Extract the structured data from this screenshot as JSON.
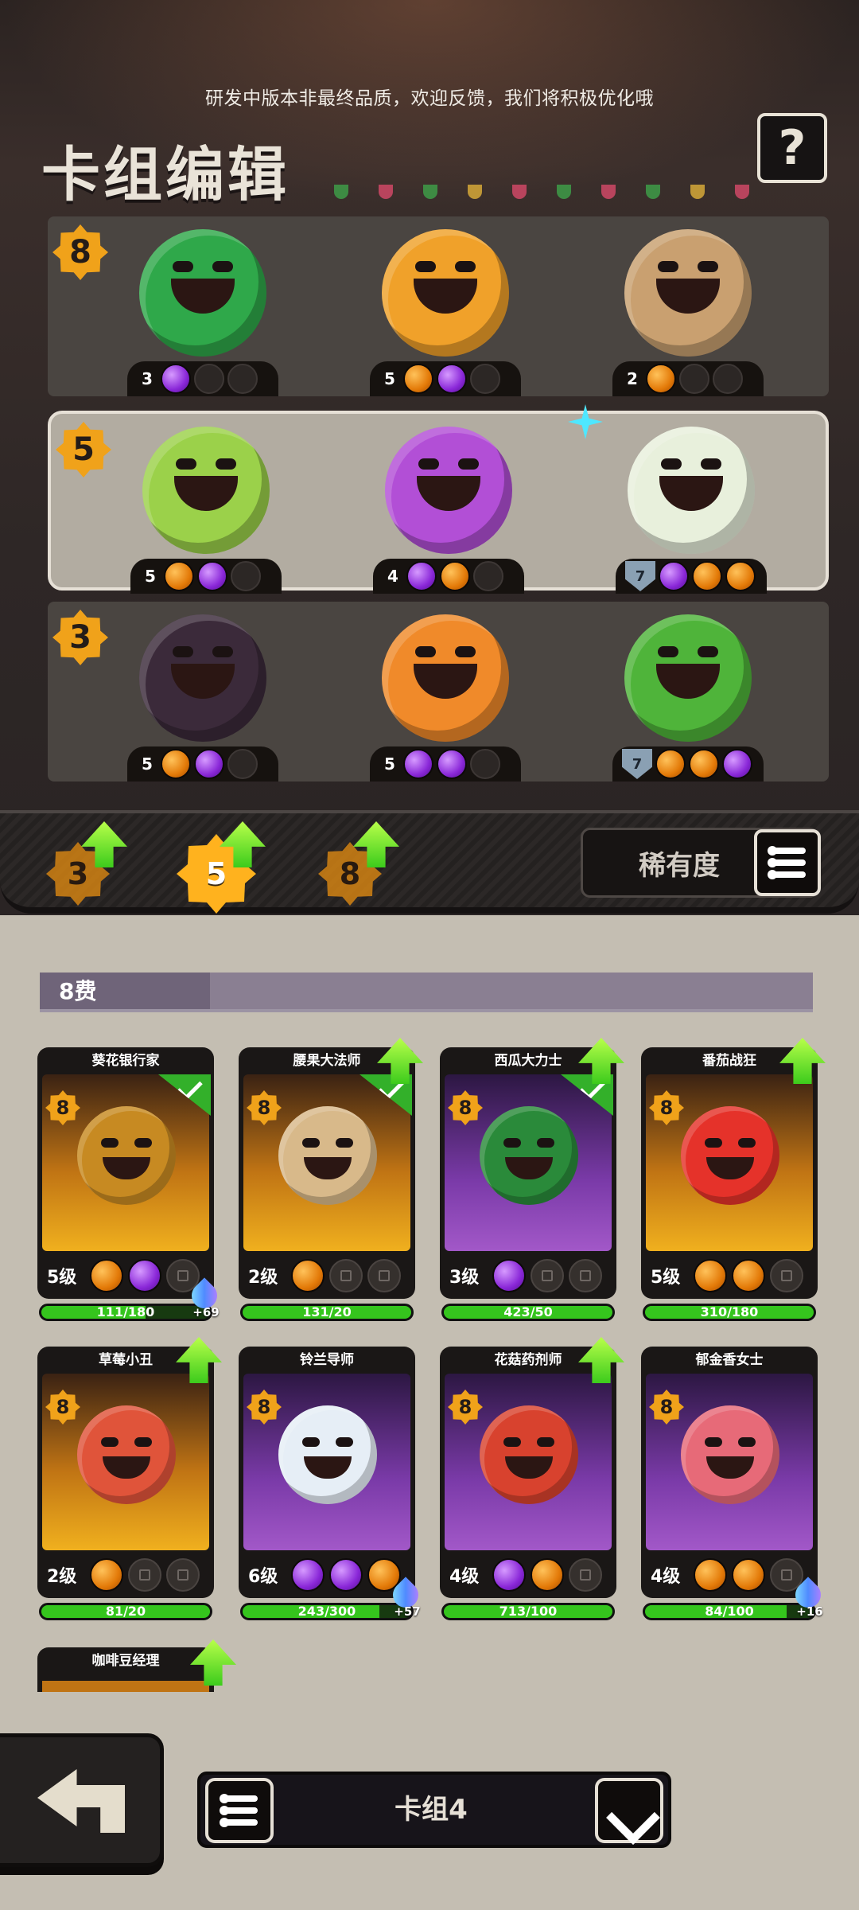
{
  "notice": "研发中版本非最终品质，欢迎反馈，我们将积极优化哦",
  "title": "卡组编辑",
  "help_label": "?",
  "deck_rows": [
    {
      "cost": "8",
      "slots": [
        {
          "level": "3",
          "gems": [
            "purple",
            "empty",
            "empty"
          ],
          "color": "#2fa84a"
        },
        {
          "level": "5",
          "gems": [
            "orange",
            "purple",
            "empty"
          ],
          "color": "#f0a12a"
        },
        {
          "level": "2",
          "gems": [
            "orange",
            "empty",
            "empty"
          ],
          "color": "#c9a070"
        }
      ]
    },
    {
      "cost": "5",
      "slots": [
        {
          "level": "5",
          "gems": [
            "orange",
            "purple",
            "empty"
          ],
          "color": "#9bd14a"
        },
        {
          "level": "4",
          "gems": [
            "purple",
            "orange",
            "empty"
          ],
          "color": "#b24fd6"
        },
        {
          "level": "7",
          "gems": [
            "purple",
            "orange",
            "orange"
          ],
          "color": "#e8f0dc",
          "shield": true
        }
      ]
    },
    {
      "cost": "3",
      "slots": [
        {
          "level": "5",
          "gems": [
            "orange",
            "purple",
            "empty"
          ],
          "color": "#3b2a3a"
        },
        {
          "level": "5",
          "gems": [
            "purple",
            "purple",
            "empty"
          ],
          "color": "#f08a2a"
        },
        {
          "level": "7",
          "gems": [
            "orange",
            "orange",
            "purple"
          ],
          "color": "#4fb43a",
          "shield": true
        }
      ]
    }
  ],
  "cost_filters": [
    "3",
    "5",
    "8"
  ],
  "active_cost_filter": "5",
  "rarity_label": "稀有度",
  "section_title": "8费",
  "cards": [
    {
      "name": "葵花银行家",
      "cost": "8",
      "level": "5级",
      "gems": [
        "orange",
        "purple",
        "lock"
      ],
      "progress": "111/180",
      "progress_ratio": 0.62,
      "bg": "gold",
      "head": "#c78a22",
      "selected": true,
      "upgrade": false,
      "shards": "+69"
    },
    {
      "name": "腰果大法师",
      "cost": "8",
      "level": "2级",
      "gems": [
        "orange",
        "lock",
        "lock"
      ],
      "progress": "131/20",
      "progress_ratio": 1,
      "bg": "gold",
      "head": "#d8b98a",
      "selected": true,
      "upgrade": true
    },
    {
      "name": "西瓜大力士",
      "cost": "8",
      "level": "3级",
      "gems": [
        "purple",
        "lock",
        "lock"
      ],
      "progress": "423/50",
      "progress_ratio": 1,
      "bg": "purple",
      "head": "#2a8a3a",
      "selected": true,
      "upgrade": true
    },
    {
      "name": "番茄战狂",
      "cost": "8",
      "level": "5级",
      "gems": [
        "orange",
        "orange",
        "lock"
      ],
      "progress": "310/180",
      "progress_ratio": 1,
      "bg": "gold",
      "head": "#e5322a",
      "selected": false,
      "upgrade": true
    },
    {
      "name": "草莓小丑",
      "cost": "8",
      "level": "2级",
      "gems": [
        "orange",
        "lock",
        "lock"
      ],
      "progress": "81/20",
      "progress_ratio": 1,
      "bg": "gold",
      "head": "#e0543a",
      "selected": false,
      "upgrade": true
    },
    {
      "name": "铃兰导师",
      "cost": "8",
      "level": "6级",
      "gems": [
        "purple",
        "purple",
        "orange"
      ],
      "progress": "243/300",
      "progress_ratio": 0.81,
      "bg": "purple",
      "head": "#e6eef6",
      "selected": false,
      "upgrade": false,
      "shards": "+57"
    },
    {
      "name": "花菇药剂师",
      "cost": "8",
      "level": "4级",
      "gems": [
        "purple",
        "orange",
        "lock"
      ],
      "progress": "713/100",
      "progress_ratio": 1,
      "bg": "purple",
      "head": "#d8422e",
      "selected": false,
      "upgrade": true
    },
    {
      "name": "郁金香女士",
      "cost": "8",
      "level": "4级",
      "gems": [
        "orange",
        "orange",
        "lock"
      ],
      "progress": "84/100",
      "progress_ratio": 0.84,
      "bg": "purple",
      "head": "#e76a78",
      "selected": false,
      "upgrade": false,
      "shards": "+16"
    }
  ],
  "partial_card_name": "咖啡豆经理",
  "deck_name": "卡组4"
}
